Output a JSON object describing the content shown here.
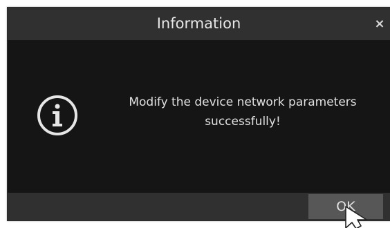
{
  "dialog": {
    "title": "Information",
    "close_glyph": "×",
    "icon": "info-circle-icon",
    "message_line1": "Modify the device network parameters",
    "message_line2": "successfully!",
    "ok_label": "OK"
  },
  "colors": {
    "dialog_background": "#151515",
    "titlebar_background": "#303030",
    "button_background": "#575757",
    "text": "#e0e0e0"
  }
}
